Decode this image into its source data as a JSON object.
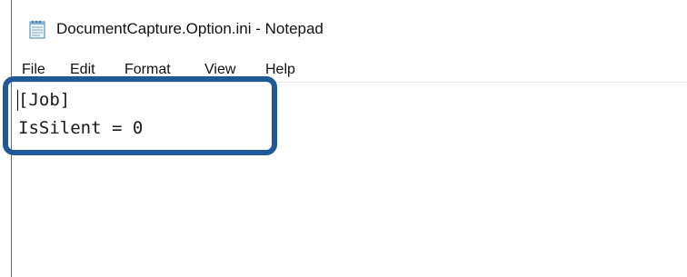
{
  "window": {
    "title": "DocumentCapture.Option.ini - Notepad",
    "app_icon": "notepad-icon"
  },
  "menu": {
    "file": "File",
    "edit": "Edit",
    "format": "Format",
    "view": "View",
    "help": "Help"
  },
  "editor": {
    "lines": [
      "[Job]",
      "IsSilent = 0"
    ]
  },
  "colors": {
    "highlight_border": "#1f5a96",
    "text": "#1a1a1a",
    "window_border": "#6e6e6e"
  }
}
